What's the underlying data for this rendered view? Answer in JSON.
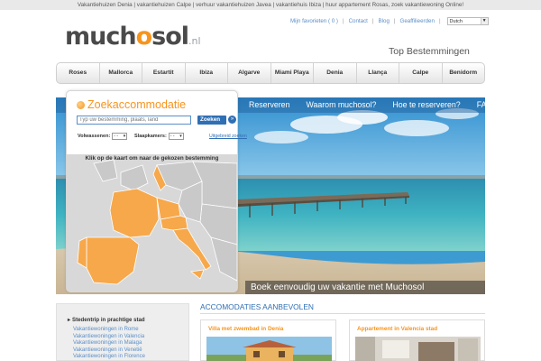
{
  "topbar": {
    "text": "Vakantiehuizen Denia | vakantiehuizen Calpe | verhuur vakantiehuizen Javea | vakantiehuis Ibiza | huur appartement Rosas, zoek vakantiewoning Online!"
  },
  "logo": {
    "main_a": "much",
    "main_o": "o",
    "main_b": "sol",
    "tld": ".nl"
  },
  "toplinks": {
    "favorites": "Mijn favorieten ( 0 )",
    "contact": "Contact",
    "blog": "Blog",
    "affiliates": "Geaffilieerden",
    "language": "Dutch"
  },
  "top_destinations": "Top Bestemmingen",
  "nav": [
    "Roses",
    "Mallorca",
    "Estartit",
    "Ibiza",
    "Algarve",
    "Miami Playa",
    "Denia",
    "Llança",
    "Calpe",
    "Benidorm"
  ],
  "hero": {
    "nav": [
      "Reserveren",
      "Waarom muchosol?",
      "Hoe te reserveren?",
      "FAQ"
    ],
    "caption": "Boek eenvoudig uw vakantie met Muchosol"
  },
  "search": {
    "title": "Zoekaccommodatie",
    "placeholder": "Typ uw bestemming, plaats, land",
    "button": "Zoeken",
    "go": "»",
    "adults_label": "Volwassenen:",
    "adults_value": "- -",
    "bedrooms_label": "Slaapkamers:",
    "bedrooms_value": "- -",
    "advanced": "Uitgebreid zoeken"
  },
  "map": {
    "caption": "Klik op de kaart om naar de gekozen bestemming"
  },
  "sidebar": {
    "heading": "Stedentrip in prachtige stad",
    "links": [
      "Vakantiewoningen in Rome",
      "Vakantiewoningen in Valencia",
      "Vakantiewoningen in Malaga",
      "Vakantiewoningen in Venetië",
      "Vakantiewoningen in Florence"
    ]
  },
  "recommended": {
    "title": "ACCOMODATIES AANBEVOLEN",
    "cards": [
      {
        "title": "Villa met zwembad in Denia"
      },
      {
        "title": "Appartement in Valencia stad"
      }
    ]
  },
  "colors": {
    "brand_orange": "#f7941d",
    "link_blue": "#5b8fc7",
    "button_blue": "#2f6fb4"
  }
}
